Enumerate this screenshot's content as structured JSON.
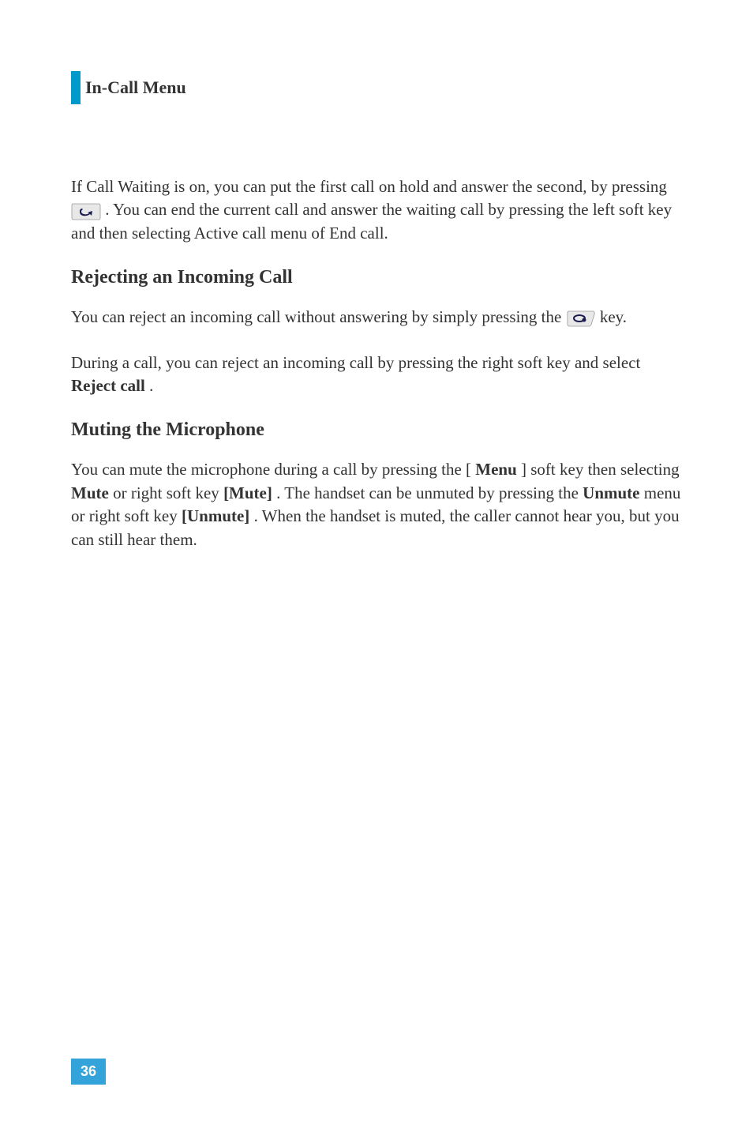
{
  "header": {
    "title": "In-Call Menu"
  },
  "paragraphs": {
    "p1_part1": "If Call Waiting is on, you can put the first call on hold and answer the second, by pressing ",
    "p1_part2": " . You can end the current call and answer the waiting call by pressing the left soft key and then selecting Active call menu of End call."
  },
  "section1": {
    "heading": "Rejecting an Incoming Call",
    "p1_part1": "You can reject an incoming call without answering by simply pressing the ",
    "p1_part2": " key.",
    "p2_part1": "During a call, you can reject an incoming call by pressing the right soft key and select ",
    "p2_bold": "Reject call",
    "p2_part2": "."
  },
  "section2": {
    "heading": "Muting the Microphone",
    "p1_part1": "You can mute the microphone during a call by pressing the [",
    "p1_bold1": "Menu",
    "p1_part2": "] soft key then selecting ",
    "p1_bold2": "Mute",
    "p1_part3": " or right soft key ",
    "p1_bold3": "[Mute]",
    "p1_part4": ". The handset can be unmuted by pressing the ",
    "p1_bold4": "Unmute",
    "p1_part5": " menu or right soft key ",
    "p1_bold5": "[Unmute]",
    "p1_part6": ". When the handset is muted, the caller cannot hear you, but you can still hear them."
  },
  "page_number": "36"
}
